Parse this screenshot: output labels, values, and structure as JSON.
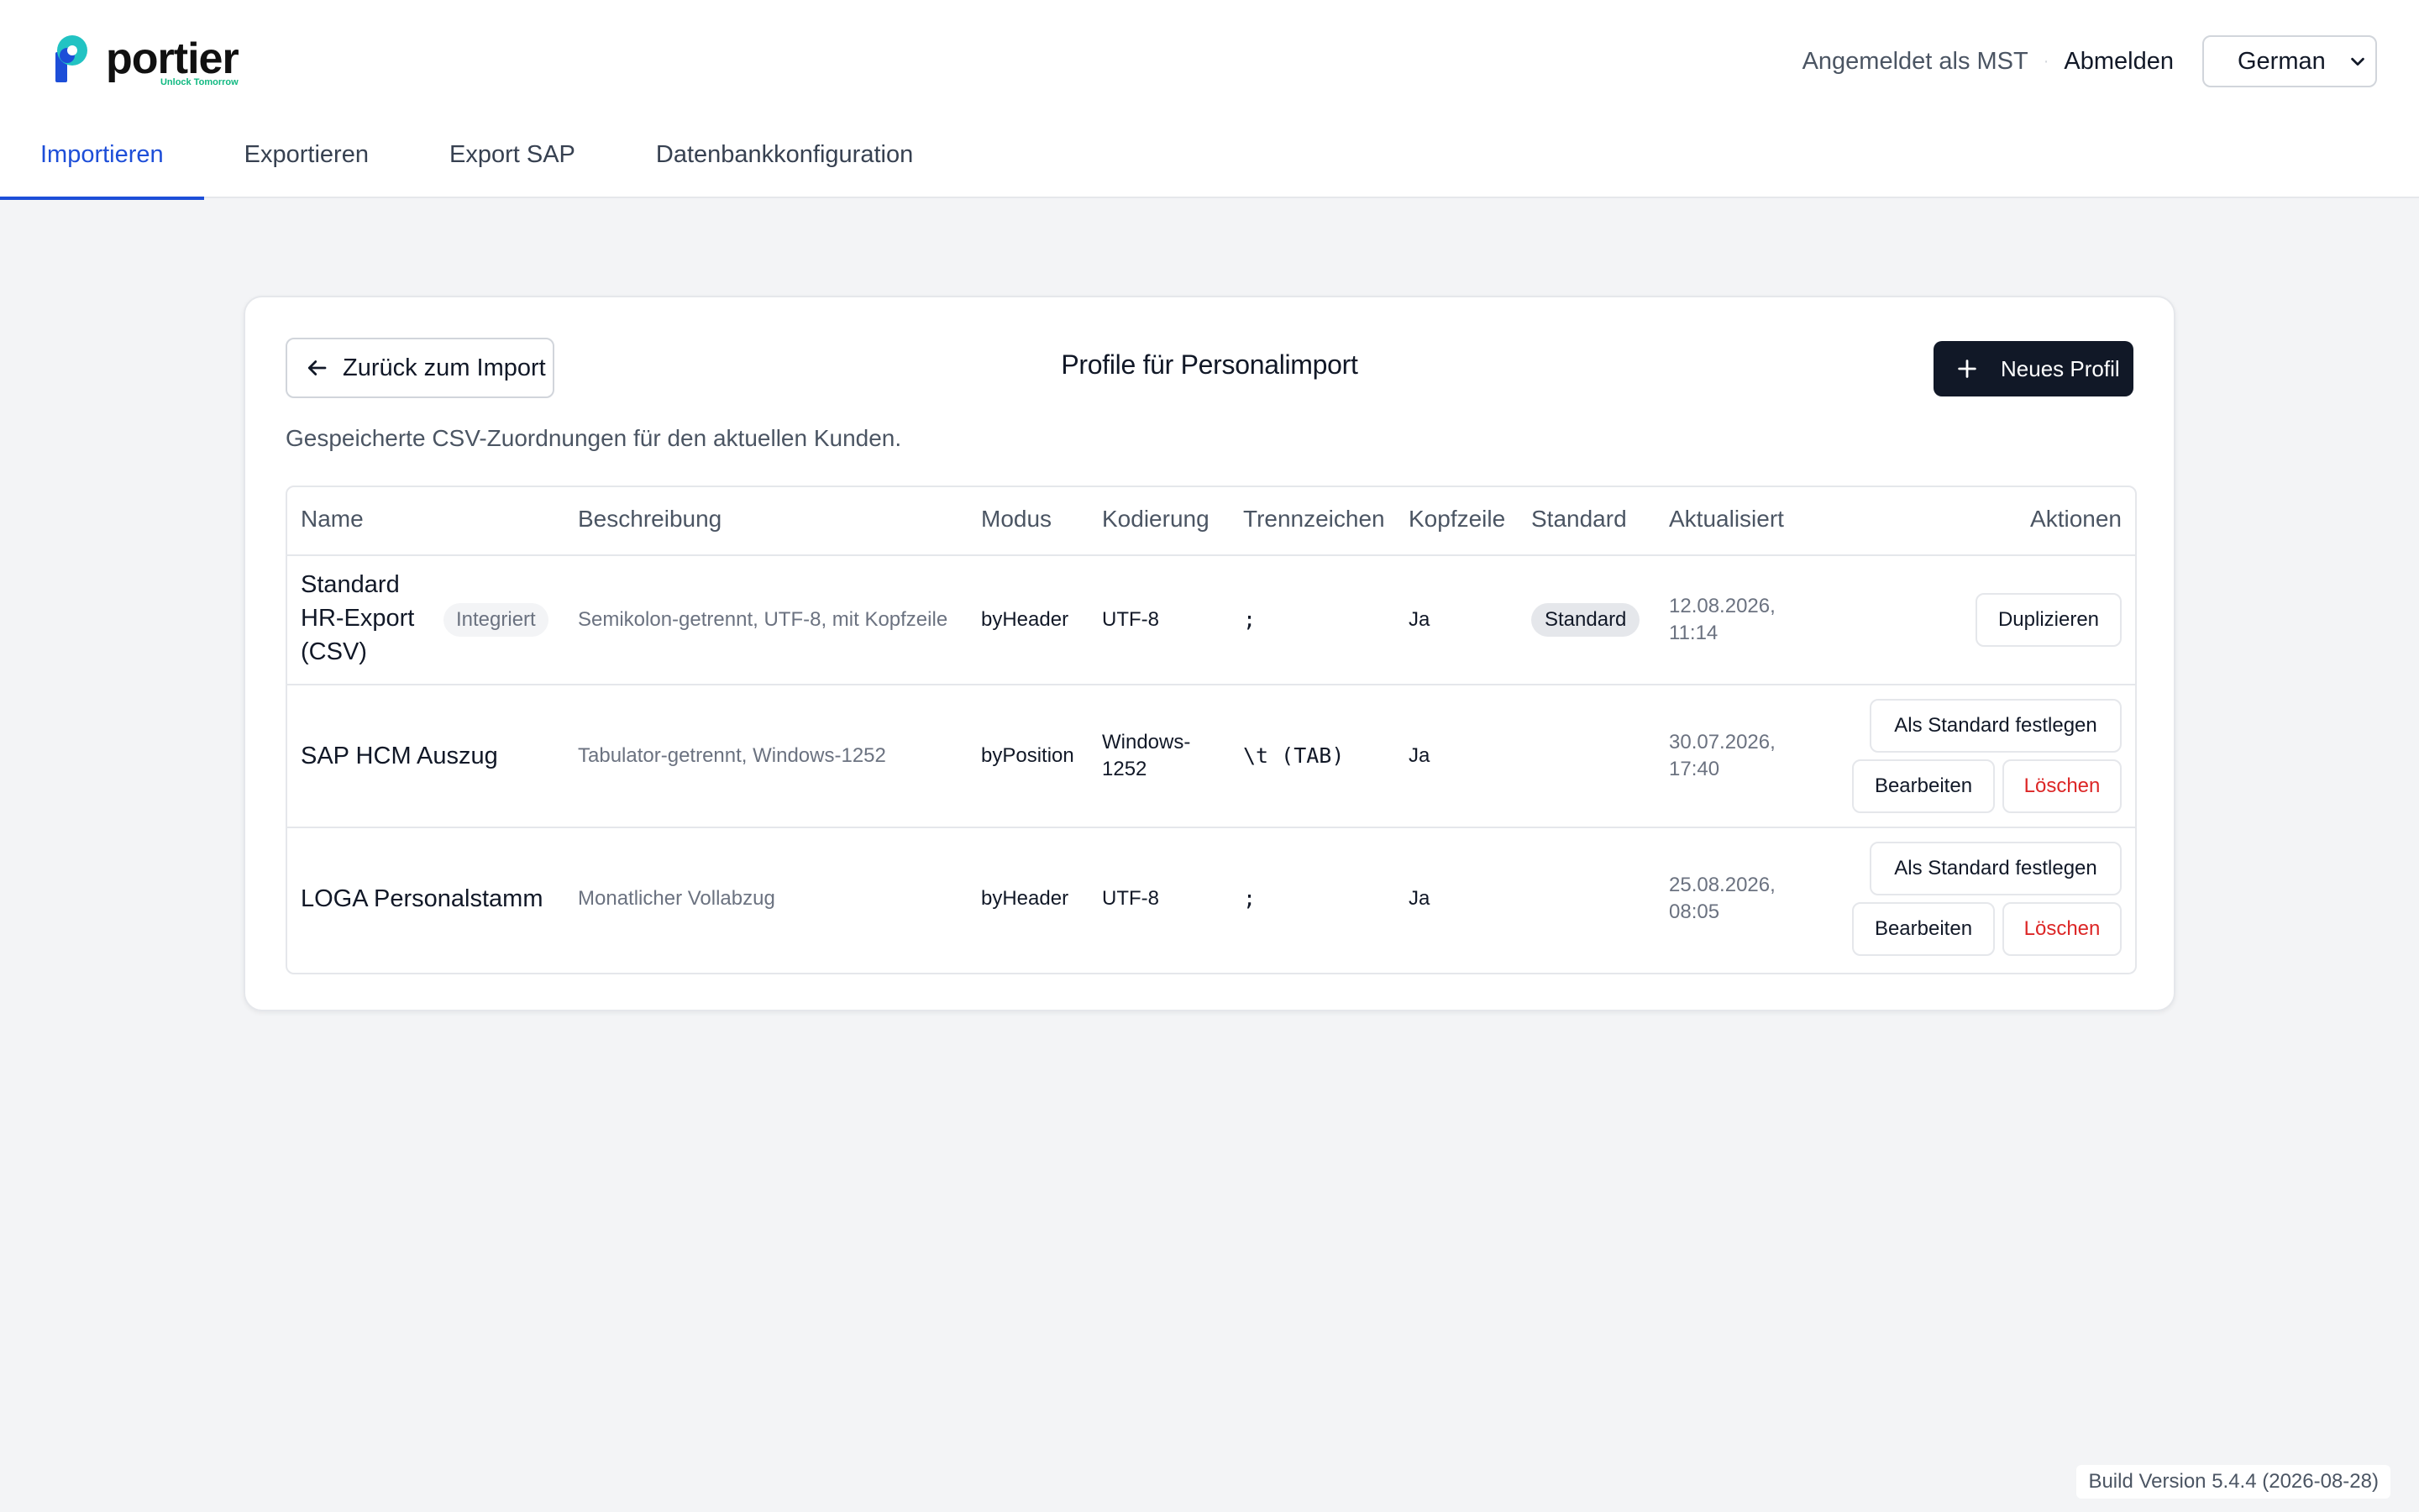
{
  "brand": {
    "name": "portier",
    "tagline": "Unlock Tomorrow",
    "accent": "#1d4ed8",
    "logo_colors": [
      "#22c3c3",
      "#1d4ed8",
      "#111111"
    ]
  },
  "user": {
    "logged_in_text": "Angemeldet als MST",
    "logout_label": "Abmelden",
    "language_selected": "German"
  },
  "nav": {
    "tabs": [
      {
        "label": "Importieren",
        "active": true
      },
      {
        "label": "Exportieren",
        "active": false
      },
      {
        "label": "Export SAP",
        "active": false
      },
      {
        "label": "Datenbankkonfiguration",
        "active": false
      }
    ]
  },
  "page": {
    "back_label": "Zurück zum Import",
    "title": "Profile für Personalimport",
    "new_label": "Neues Profil",
    "subtitle": "Gespeicherte CSV-Zuordnungen für den aktuellen Kunden."
  },
  "table": {
    "headers": {
      "name": "Name",
      "description": "Beschreibung",
      "mode": "Modus",
      "encoding": "Kodierung",
      "delimiter": "Trennzeichen",
      "header_row": "Kopfzeile",
      "default": "Standard",
      "updated": "Aktualisiert",
      "actions": "Aktionen"
    },
    "rows": [
      {
        "name_lines": [
          "Standard",
          "HR-Export",
          "(CSV)"
        ],
        "builtin_badge": "Integriert",
        "description": "Semikolon-getrennt, UTF-8, mit Kopfzeile",
        "mode": "byHeader",
        "encoding": "UTF-8",
        "delimiter": ";",
        "header_row": "Ja",
        "default_badge": "Standard",
        "updated_date": "12.08.2026,",
        "updated_time": "11:14",
        "duplicate_label": "Duplizieren"
      },
      {
        "name": "SAP HCM Auszug",
        "description": "Tabulator-getrennt, Windows-1252",
        "mode": "byPosition",
        "encoding_lines": [
          "Windows-",
          "1252"
        ],
        "delimiter": "\\t (TAB)",
        "header_row": "Ja",
        "updated_date": "30.07.2026,",
        "updated_time": "17:40",
        "set_default_label": "Als Standard festlegen",
        "edit_label": "Bearbeiten",
        "delete_label": "Löschen"
      },
      {
        "name": "LOGA Personalstamm",
        "description": "Monatlicher Vollabzug",
        "mode": "byHeader",
        "encoding": "UTF-8",
        "delimiter": ";",
        "header_row": "Ja",
        "updated_date": "25.08.2026,",
        "updated_time": "08:05",
        "set_default_label": "Als Standard festlegen",
        "edit_label": "Bearbeiten",
        "delete_label": "Löschen"
      }
    ]
  },
  "footer": {
    "build_version": "Build Version 5.4.4 (2026-08-28)"
  }
}
